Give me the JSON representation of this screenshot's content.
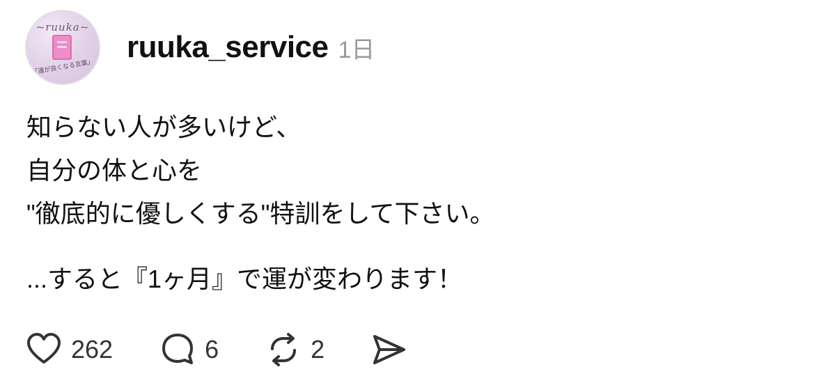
{
  "post": {
    "avatar": {
      "brand": "~ruuka~",
      "script": "Book of language",
      "tagline": "「運が良くなる言葉」"
    },
    "username": "ruuka_service",
    "time_ago": "1日",
    "lines": [
      "知らない人が多いけど、",
      "自分の体と心を",
      "\"徹底的に優しくする\"特訓をして下さい。",
      "...すると『1ヶ月』で運が変わります！"
    ],
    "stats": {
      "likes": "262",
      "comments": "6",
      "reposts": "2"
    }
  },
  "icons": {
    "like": "heart-icon",
    "comment": "speech-bubble-icon",
    "repost": "repost-arrows-icon",
    "share": "paper-plane-icon"
  },
  "colors": {
    "text": "#111111",
    "muted": "#9a9a9a",
    "icon": "#333333"
  }
}
